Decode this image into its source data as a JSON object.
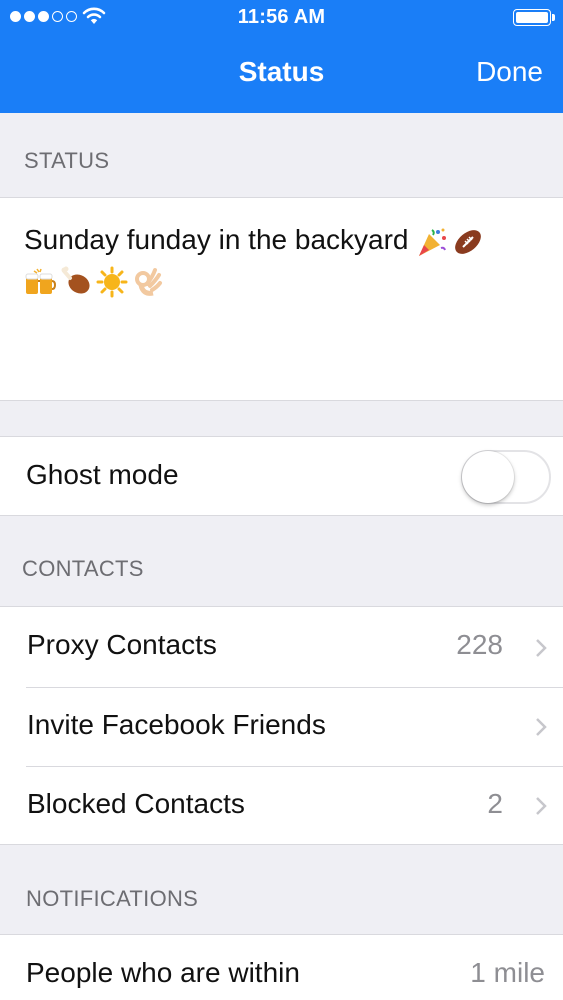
{
  "status_bar": {
    "time": "11:56 AM",
    "signal_filled": 3,
    "signal_total": 5
  },
  "nav": {
    "title": "Status",
    "done_label": "Done"
  },
  "status_section": {
    "header": "STATUS",
    "text": "Sunday funday in the backyard",
    "emojis_line1": [
      "party-popper-icon",
      "football-icon"
    ],
    "emojis_line2": [
      "beer-mugs-icon",
      "poultry-leg-icon",
      "sun-icon",
      "ok-hand-icon"
    ]
  },
  "ghost_mode": {
    "label": "Ghost mode",
    "enabled": false
  },
  "contacts_section": {
    "header": "CONTACTS",
    "items": [
      {
        "label": "Proxy Contacts",
        "value": "228"
      },
      {
        "label": "Invite Facebook Friends",
        "value": ""
      },
      {
        "label": "Blocked Contacts",
        "value": "2"
      }
    ]
  },
  "notifications_section": {
    "header": "NOTIFICATIONS",
    "items": [
      {
        "label": "People who are within",
        "value": "1 mile"
      }
    ]
  },
  "colors": {
    "nav_blue": "#1a7ef7",
    "background": "#efeff4",
    "secondary_text": "#8e8e93"
  }
}
